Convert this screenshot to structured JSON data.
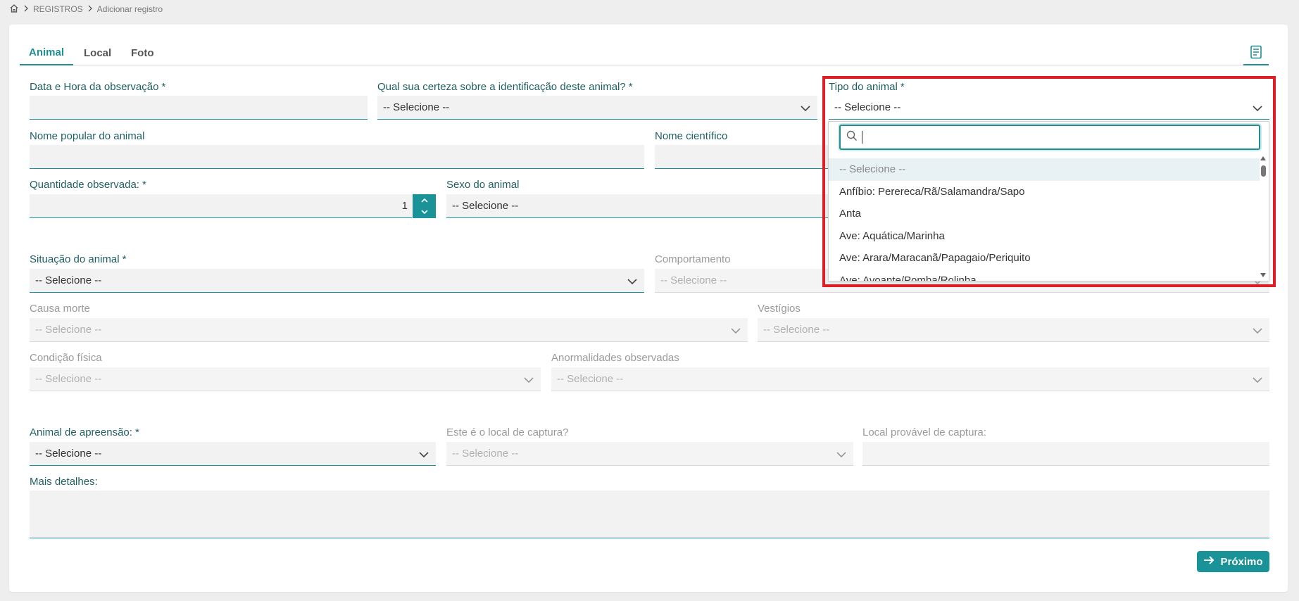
{
  "breadcrumb": {
    "home_icon": "home-icon",
    "items": [
      "REGISTROS",
      "Adicionar registro"
    ]
  },
  "tabs": [
    {
      "label": "Animal",
      "active": true
    },
    {
      "label": "Local",
      "active": false
    },
    {
      "label": "Foto",
      "active": false
    }
  ],
  "form": {
    "data_hora": {
      "label": "Data e Hora da observação",
      "required": "*",
      "value": ""
    },
    "certeza": {
      "label": "Qual sua certeza sobre a identificação deste animal?",
      "required": "*",
      "value": "-- Selecione --"
    },
    "tipo": {
      "label": "Tipo do animal",
      "required": "*",
      "value": "-- Selecione --"
    },
    "nome_popular": {
      "label": "Nome popular do animal",
      "value": ""
    },
    "nome_cientifico": {
      "label": "Nome científico",
      "value": ""
    },
    "quantidade": {
      "label": "Quantidade observada:",
      "required": "*",
      "value": "1"
    },
    "sexo": {
      "label": "Sexo do animal",
      "value": "-- Selecione --"
    },
    "situacao": {
      "label": "Situação do animal",
      "required": "*",
      "value": "-- Selecione --"
    },
    "comportamento": {
      "label": "Comportamento",
      "value": "-- Selecione --"
    },
    "causa_morte": {
      "label": "Causa morte",
      "value": "-- Selecione --"
    },
    "vestigios": {
      "label": "Vestígios",
      "value": "-- Selecione --"
    },
    "condicao_fisica": {
      "label": "Condição física",
      "value": "-- Selecione --"
    },
    "anormalidades": {
      "label": "Anormalidades observadas",
      "value": "-- Selecione --"
    },
    "apreensao": {
      "label": "Animal de apreensão:",
      "required": "*",
      "value": "-- Selecione --"
    },
    "local_captura": {
      "label": "Este é o local de captura?",
      "value": "-- Selecione --"
    },
    "local_provavel": {
      "label": "Local provável de captura:",
      "value": ""
    },
    "mais_detalhes": {
      "label": "Mais detalhes:",
      "value": ""
    }
  },
  "dropdown": {
    "search_value": "",
    "options": [
      "-- Selecione --",
      "Anfíbio: Perereca/Rã/Salamandra/Sapo",
      "Anta",
      "Ave: Aquática/Marinha",
      "Ave: Arara/Maracanã/Papagaio/Periquito",
      "Ave: Avoante/Pomba/Rolinha"
    ]
  },
  "next_button": {
    "label": "Próximo"
  },
  "colors": {
    "accent": "#1a9398",
    "highlight": "#e01e26"
  }
}
